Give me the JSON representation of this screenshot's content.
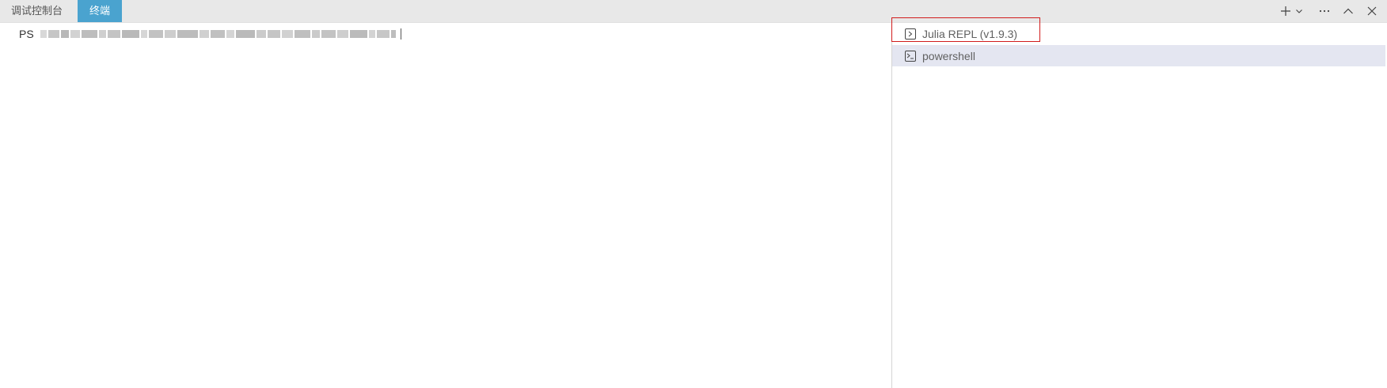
{
  "tabs": [
    {
      "label": "调试控制台",
      "active": false
    },
    {
      "label": "终端",
      "active": true
    }
  ],
  "actions": {
    "new_terminal": "plus-icon",
    "dropdown": "chevron-down-icon",
    "more": "ellipsis-icon",
    "maximize": "chevron-up-icon",
    "close": "close-icon"
  },
  "terminal": {
    "prompt": "PS"
  },
  "terminal_list": [
    {
      "label": "Julia REPL (v1.9.3)",
      "icon": "terminal-icon",
      "selected": false
    },
    {
      "label": "powershell",
      "icon": "powershell-icon",
      "selected": true
    }
  ],
  "colors": {
    "tab_active_bg": "#4aa3cf",
    "tabbar_bg": "#e8e8e8",
    "selected_item_bg": "#e4e6f1",
    "highlight_border": "#d11c1c"
  }
}
